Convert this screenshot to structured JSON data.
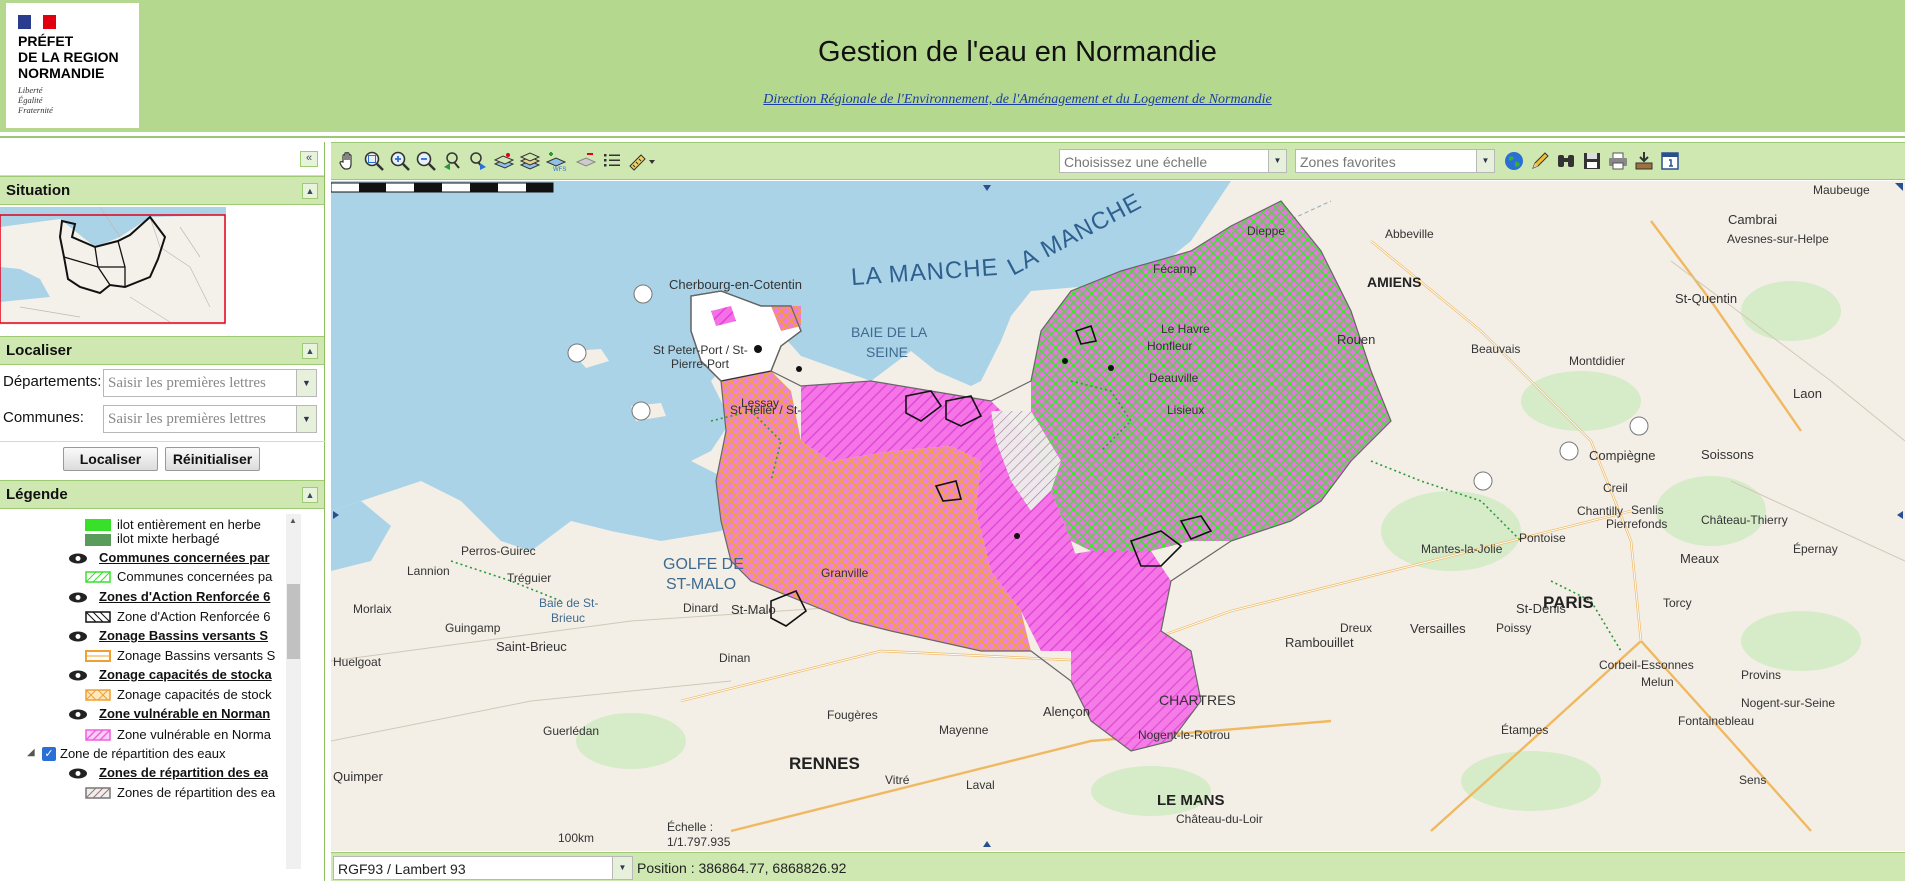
{
  "header": {
    "title": "Gestion de l'eau en Normandie",
    "subtitle": "Direction Régionale de l'Environnement, de l'Aménagement et du Logement de Normandie",
    "logo": {
      "line1": "PRÉFET",
      "line2": "DE LA REGION",
      "line3": "NORMANDIE",
      "motto1": "Liberté",
      "motto2": "Égalité",
      "motto3": "Fraternité"
    }
  },
  "colors": {
    "header_bg": "#b5d88f",
    "panel_head": "#cfe8b1",
    "sea": "#aad3e8",
    "vulnerable_zone": "#f25ee0",
    "zar_orange": "#f0a030",
    "herb_green": "#39e02a"
  },
  "sidebar": {
    "collapse_icon": "double-chevron-left-icon",
    "situation": {
      "title": "Situation"
    },
    "localiser": {
      "title": "Localiser",
      "departements_label": "Départements:",
      "departements_placeholder": "Saisir les premières lettres",
      "communes_label": "Communes:",
      "communes_placeholder": "Saisir les premières lettres",
      "localiser_button": "Localiser",
      "reinitialiser_button": "Réinitialiser"
    },
    "legende": {
      "title": "Légende",
      "items": [
        {
          "label": "ilot entièrement en herbe",
          "kind": "swatch"
        },
        {
          "label": "ilot mixte herbagé",
          "kind": "swatch"
        },
        {
          "label": "Communes concernées par",
          "kind": "layer"
        },
        {
          "label": "Communes concernées pa",
          "kind": "swatch"
        },
        {
          "label": "Zones d'Action Renforcée 6",
          "kind": "layer"
        },
        {
          "label": "Zone d'Action Renforcée 6",
          "kind": "swatch"
        },
        {
          "label": "Zonage Bassins versants S",
          "kind": "layer"
        },
        {
          "label": "Zonage Bassins versants S",
          "kind": "swatch"
        },
        {
          "label": "Zonage capacités de stocka",
          "kind": "layer"
        },
        {
          "label": "Zonage capacités de stock",
          "kind": "swatch"
        },
        {
          "label": "Zone vulnérable en Norman",
          "kind": "layer"
        },
        {
          "label": "Zone vulnérable en Norma",
          "kind": "swatch"
        },
        {
          "label": "Zone de répartition des eaux",
          "kind": "group"
        },
        {
          "label": "Zones de répartition des ea",
          "kind": "layer"
        },
        {
          "label": "Zones de répartition des ea",
          "kind": "swatch"
        }
      ]
    }
  },
  "toolbar": {
    "tools": [
      "pan-hand-icon",
      "zoom-extent-icon",
      "zoom-in-icon",
      "zoom-out-icon",
      "previous-view-icon",
      "next-view-icon",
      "layers-icon",
      "layers-stack-icon",
      "add-wms-icon",
      "remove-layer-icon",
      "list-icon",
      "measure-icon"
    ],
    "scale_placeholder": "Choisissez une échelle",
    "zones_placeholder": "Zones favorites",
    "right_tools": [
      "globe-icon",
      "pencil-icon",
      "binoculars-icon",
      "save-icon",
      "print-icon",
      "export-icon",
      "info-window-icon"
    ]
  },
  "map": {
    "sea_labels": [
      "LA MANCHE",
      "LA MANCHE",
      "BAIE DE LA",
      "SEINE",
      "GOLFE DE",
      "ST-MALO"
    ],
    "cities": [
      "AMIENS",
      "PARIS",
      "RENNES",
      "LE MANS",
      "CHARTRES"
    ],
    "places": [
      "Cherbourg-en-Cotentin",
      "St Peter-Port / St-",
      "Pierre-Port",
      "St Helier / St-",
      "Perros-Guirec",
      "Lannion",
      "Tréguier",
      "Morlaix",
      "Guingamp",
      "Baie de St-",
      "Brieuc",
      "Saint-Brieuc",
      "Dinard",
      "St-Malo",
      "Huelgoat",
      "Dinan",
      "Granville",
      "Fougères",
      "Vitré",
      "Mayenne",
      "Laval",
      "Alençon",
      "Nogent-le-Rotrou",
      "Rambouillet",
      "Versailles",
      "Dreux",
      "Mantes-la-Jolie",
      "Pontoise",
      "Chantilly",
      "Senlis",
      "Creil",
      "Compiègne",
      "Soissons",
      "Laon",
      "Montdidier",
      "St-Quentin",
      "Abbeville",
      "Cambrai",
      "Avesnes-sur-Helpe",
      "Maubeuge",
      "Dieppe",
      "Fécamp",
      "Le Havre",
      "Honfleur",
      "Deauville",
      "Lisieux",
      "Rouen",
      "Beauvais",
      "Meaux",
      "Château-Thierry",
      "Épernay",
      "Corbeil-Essonnes",
      "Melun",
      "Provins",
      "Nogent-sur-Seine",
      "Fontainebleau",
      "Sens",
      "Étampes",
      "Guerlédan",
      "Quimper",
      "Château-du-Loir",
      "Poissy",
      "St-Denis",
      "Torcy",
      "Pierrefonds",
      "Lessay"
    ],
    "scale_bar_label": "100km",
    "scale_label": "Échelle :",
    "scale_value": "1/1.797.935"
  },
  "statusbar": {
    "projection": "RGF93 / Lambert 93",
    "position": "Position : 386864.77, 6868826.92"
  }
}
